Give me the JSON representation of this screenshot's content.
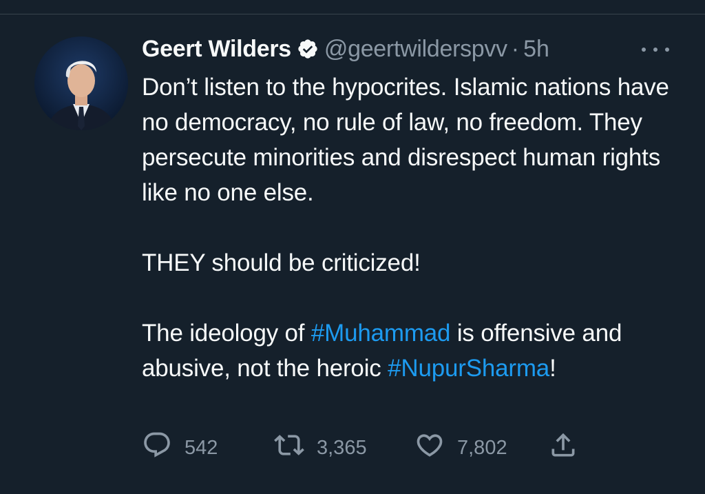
{
  "author": {
    "display_name": "Geert Wilders",
    "handle": "@geertwilderspvv",
    "separator": "·",
    "time": "5h",
    "verified": true
  },
  "tweet": {
    "paragraphs": [
      {
        "text": "Don’t listen to the hypocrites. Islamic nations have no democracy, no rule of law, no freedom. They persecute minorities and disrespect human rights like no one else."
      },
      {
        "text": "THEY should be criticized!"
      },
      {
        "text_before": "The ideology of ",
        "hashtag1": "#Muhammad",
        "text_middle": " is offensive and abusive, not the heroic ",
        "hashtag2": "#NupurSharma",
        "text_after": "!"
      }
    ]
  },
  "actions": {
    "replies": "542",
    "retweets": "3,365",
    "likes": "7,802"
  },
  "icons": {
    "reply": "speech-bubble-icon",
    "retweet": "retweet-arrows-icon",
    "like": "heart-icon",
    "share": "share-upload-icon",
    "more": "more-dots-icon",
    "verified": "verified-badge-icon"
  },
  "colors": {
    "background": "#15202b",
    "text": "#f7f9f9",
    "secondary": "#8b98a5",
    "link": "#1d9bf0",
    "divider": "#38444d"
  }
}
